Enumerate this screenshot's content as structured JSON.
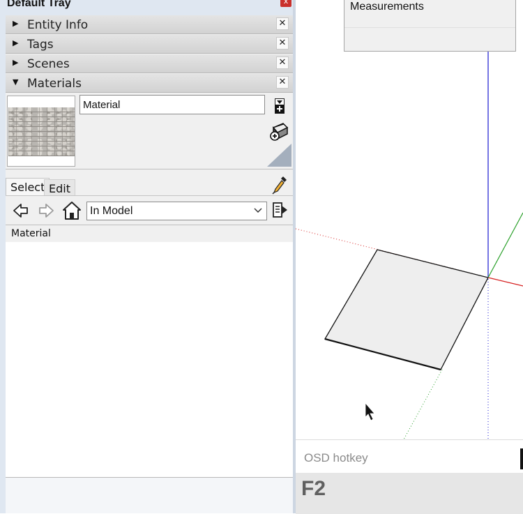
{
  "tray": {
    "title": "Default Tray",
    "close_glyph": "x",
    "panels": [
      {
        "label": "Entity Info",
        "expanded": false
      },
      {
        "label": "Tags",
        "expanded": false
      },
      {
        "label": "Scenes",
        "expanded": false
      },
      {
        "label": "Materials",
        "expanded": true
      }
    ],
    "panel_close_glyph": "✕"
  },
  "materials": {
    "name_value": "Material",
    "tabs": {
      "select": "Select",
      "edit": "Edit"
    },
    "collection": "In Model",
    "list_header": "Material",
    "icons": [
      "create-material-icon",
      "sample-paint-icon",
      "default-material-icon",
      "eyedropper-icon",
      "back-arrow-icon",
      "forward-arrow-icon",
      "home-icon",
      "details-icon",
      "chevron-down-icon"
    ]
  },
  "viewport": {
    "measurements_label": "Measurements",
    "osd_label": "OSD hotkey",
    "osd_key": "F2",
    "colors": {
      "red_axis": "#d62020",
      "green_axis": "#2aa02a",
      "blue_axis": "#1a1ad0",
      "face": "#eeeeee"
    }
  }
}
